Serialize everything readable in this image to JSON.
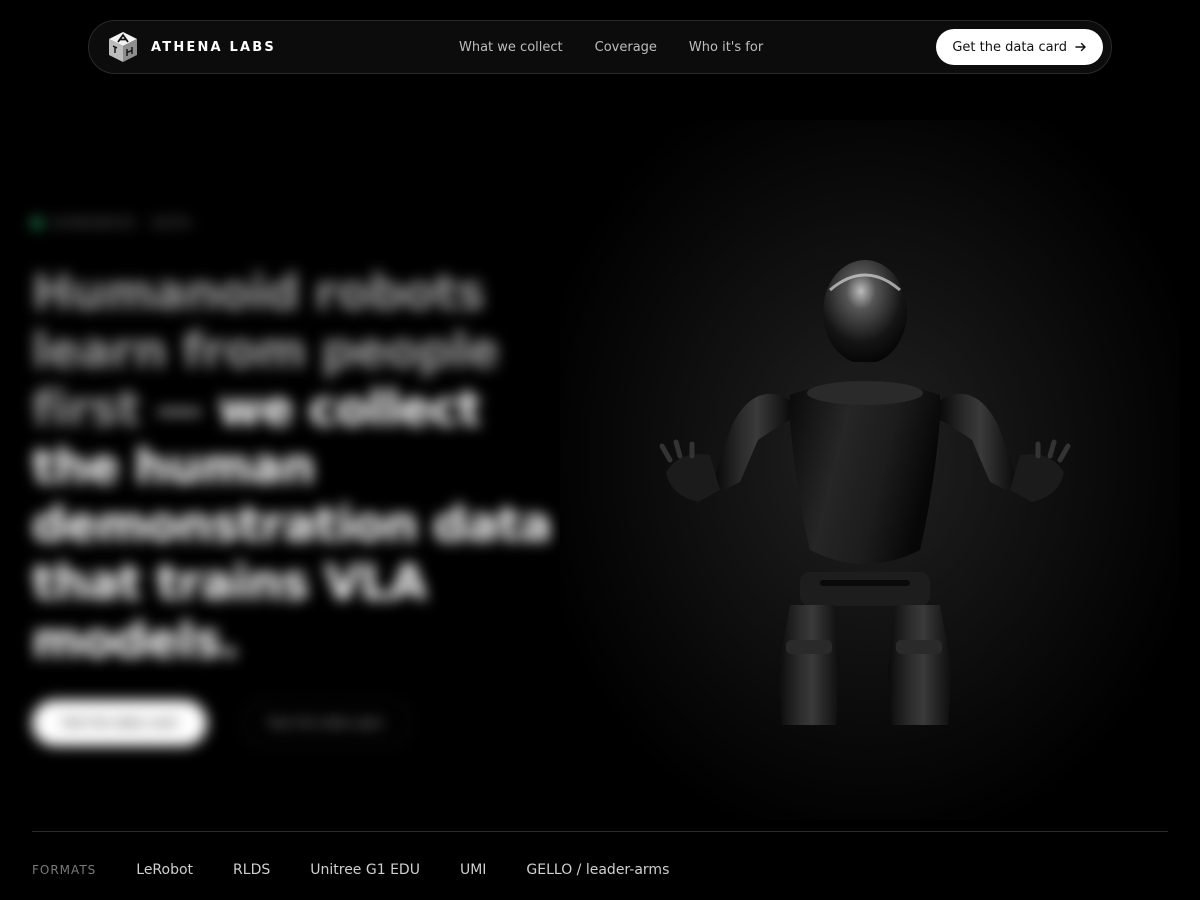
{
  "nav": {
    "brand": "ATHENA LABS",
    "links": [
      "What we collect",
      "Coverage",
      "Who it's for"
    ],
    "cta_label": "Get the data card"
  },
  "hero": {
    "eyebrow": "HUMANOID · DATA",
    "headline_dim": "Humanoid robots learn from people first — ",
    "headline_strong": "we collect the human demonstration data that trains VLA models.",
    "primary_button": "Get the data card",
    "secondary_button": "See the data spec"
  },
  "formats": {
    "label": "FORMATS",
    "items": [
      "LeRobot",
      "RLDS",
      "Unitree G1 EDU",
      "UMI",
      "GELLO / leader-arms"
    ]
  },
  "colors": {
    "background": "#000000",
    "accent_green": "#2fbf71",
    "cta_bg": "#ffffff"
  },
  "icons": {
    "brand": "cube-logo-icon",
    "cta": "arrow-right-icon",
    "eyebrow": "status-dot-icon",
    "hero_image": "humanoid-robot"
  }
}
